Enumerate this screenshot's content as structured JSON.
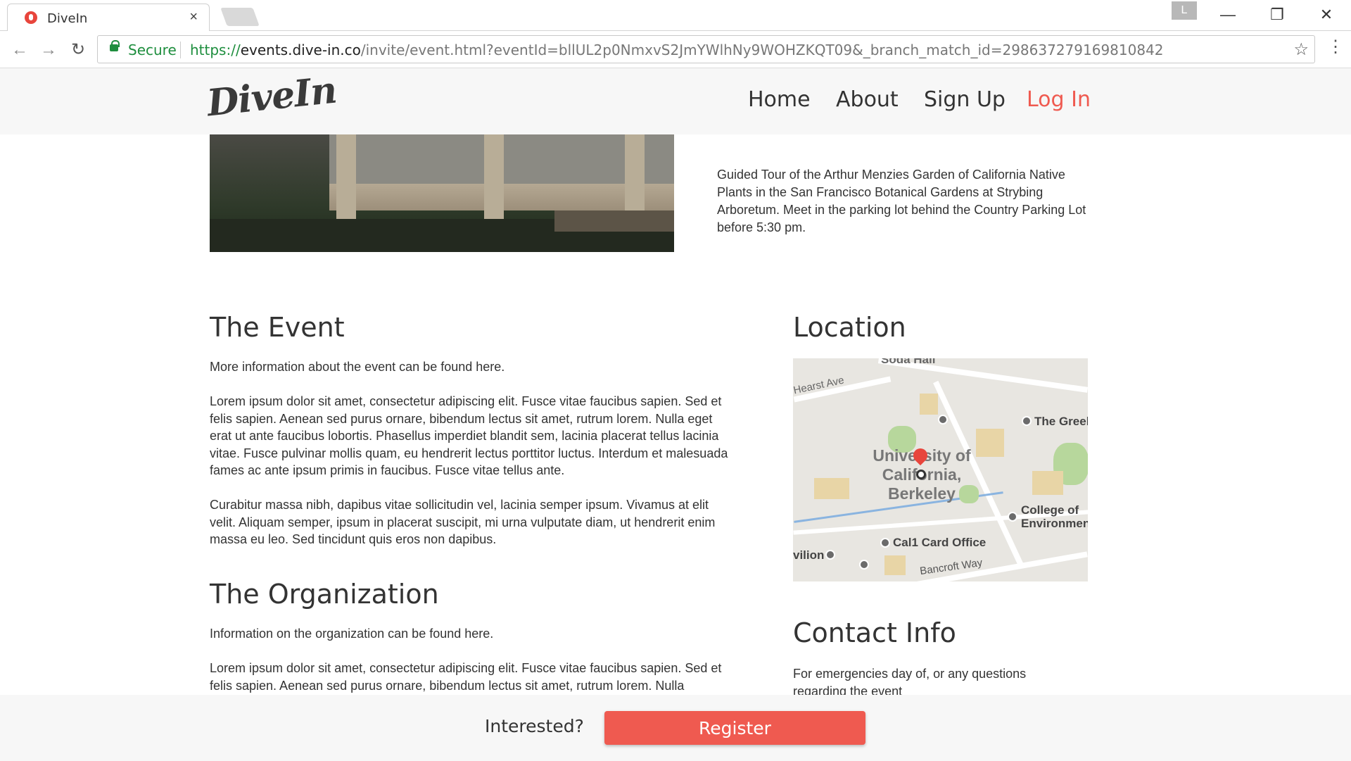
{
  "browser": {
    "tab_title": "DiveIn",
    "tab_close": "×",
    "profile_letter": "L",
    "secure_label": "Secure",
    "url_scheme": "https://",
    "url_host": "events.dive-in.co",
    "url_path": "/invite/event.html?eventId=bllUL2p0NmxvS2JmYWlhNy9WOHZKQT09&_branch_match_id=298637279169810842"
  },
  "header": {
    "logo": "DiveIn",
    "nav": {
      "home": "Home",
      "about": "About",
      "signup": "Sign Up",
      "login": "Log In"
    }
  },
  "hero": {
    "description": "Guided Tour of the Arthur Menzies Garden of California Native Plants in the San Francisco Botanical Gardens at Strybing Arboretum. Meet in the parking lot behind the Country Parking Lot before 5:30 pm."
  },
  "event": {
    "heading": "The Event",
    "intro": "More information about the event can be found here.",
    "para1": "Lorem ipsum dolor sit amet, consectetur adipiscing elit. Fusce vitae faucibus sapien. Sed et felis sapien. Aenean sed purus ornare, bibendum lectus sit amet, rutrum lorem. Nulla eget erat ut ante faucibus lobortis. Phasellus imperdiet blandit sem, lacinia placerat tellus lacinia vitae. Fusce pulvinar mollis quam, eu hendrerit lectus porttitor luctus. Interdum et malesuada fames ac ante ipsum primis in faucibus. Fusce vitae tellus ante.",
    "para2": "Curabitur massa nibh, dapibus vitae sollicitudin vel, lacinia semper ipsum. Vivamus at elit velit. Aliquam semper, ipsum in placerat suscipit, mi urna vulputate diam, ut hendrerit enim massa eu leo. Sed tincidunt quis eros non dapibus."
  },
  "organization": {
    "heading": "The Organization",
    "intro": "Information on the organization can be found here.",
    "para1": "Lorem ipsum dolor sit amet, consectetur adipiscing elit. Fusce vitae faucibus sapien. Sed et felis sapien. Aenean sed purus ornare, bibendum lectus sit amet, rutrum lorem. Nulla"
  },
  "location": {
    "heading": "Location",
    "map_labels": {
      "soda_hall": "Soda Hall",
      "hearst_ave": "Hearst Ave",
      "the_greek": "The Greek",
      "university": "University of California, Berkeley",
      "college": "College of Environment",
      "cal1": "Cal1 Card Office",
      "pavilion": "vilion",
      "bancroft": "Bancroft Way"
    }
  },
  "contact": {
    "heading": "Contact Info",
    "text": "For emergencies day of, or any questions regarding the event"
  },
  "footer": {
    "interested": "Interested?",
    "register": "Register"
  },
  "colors": {
    "accent": "#ef5a50",
    "secure_green": "#1e8e3e"
  }
}
